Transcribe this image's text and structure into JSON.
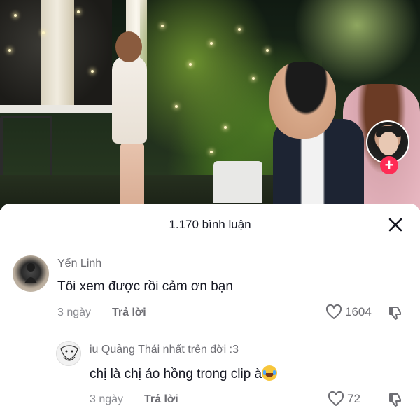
{
  "header": {
    "comment_count_label": "1.170 bình luận"
  },
  "comments": [
    {
      "username": "Yến Linh",
      "text": "Tôi xem được rồi cảm ơn bạn",
      "time": "3 ngày",
      "reply_label": "Trả lời",
      "like_count": "1604"
    },
    {
      "username": "iu Quảng Thái nhất trên đời :3",
      "text": "chị là chị áo hồng trong clip à",
      "emoji": "tears-of-joy-emoji",
      "time": "3 ngày",
      "reply_label": "Trả lời",
      "like_count": "72"
    }
  ],
  "icons": {
    "close": "close-icon",
    "like": "heart-outline-icon",
    "dislike": "thumbs-down-icon",
    "follow": "plus-icon"
  },
  "colors": {
    "follow_accent": "#fe2c55",
    "text_primary": "#161823",
    "text_secondary": "#8a8b91"
  }
}
